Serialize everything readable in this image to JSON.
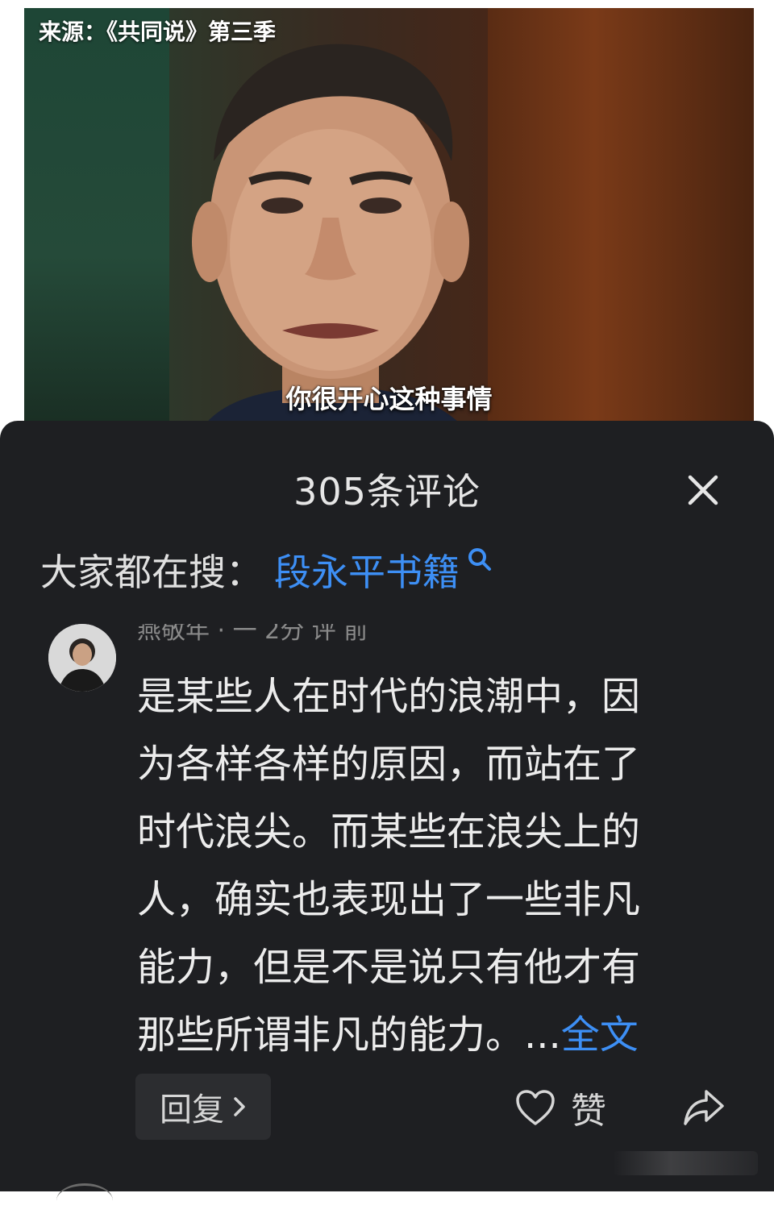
{
  "video": {
    "source_label": "来源：《共同说》第三季",
    "subtitle": "你很开心这种事情"
  },
  "comments_panel": {
    "title": "305条评论",
    "close_icon": "close-icon",
    "search": {
      "prefix": "大家都在搜：",
      "term": "段永平书籍",
      "icon": "search-icon"
    },
    "comment": {
      "avatar": "avatar",
      "meta_partial": "燕敬年 · 一 2分 评 前",
      "lines": [
        "是某些人在时代的浪潮中，因",
        "为各样各样的原因，而站在了",
        "时代浪尖。而某些在浪尖上的",
        "人，确实也表现出了一些非凡",
        "能力，但是不是说只有他才有",
        "那些所谓非凡的能力。..."
      ],
      "more_label": "全文",
      "reply_label": "回复",
      "like_label": "赞",
      "share_icon": "share-icon",
      "like_icon": "heart-icon"
    }
  },
  "colors": {
    "sheet_bg": "#1e1f22",
    "accent_blue": "#3d8ff5",
    "text_primary": "#ececec"
  }
}
